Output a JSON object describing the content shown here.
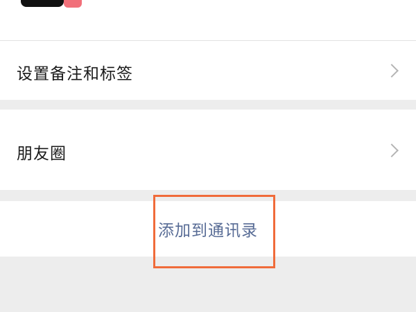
{
  "contact_detail": {
    "rows": [
      {
        "label": "设置备注和标签",
        "icon": "chevron-right-icon"
      },
      {
        "label": "朋友圈",
        "icon": "chevron-right-icon"
      }
    ],
    "add_to_contacts_label": "添加到通讯录"
  },
  "colors": {
    "page_background": "#ededed",
    "card_background": "#ffffff",
    "link_text": "#576b95",
    "highlight_border": "#f06b3a"
  }
}
